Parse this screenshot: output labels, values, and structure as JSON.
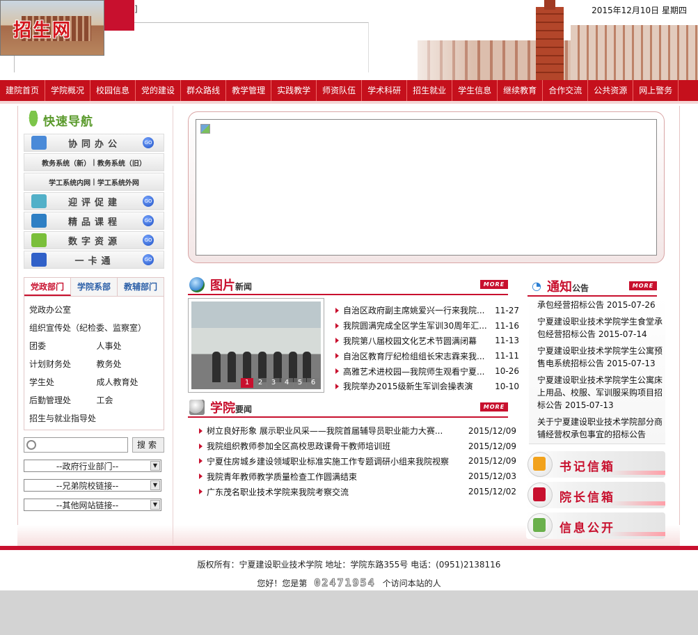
{
  "header": {
    "logo_text": "招生网",
    "bracket": "]",
    "date": "2015年12月10日  星期四"
  },
  "nav": [
    "建院首页",
    "学院概况",
    "校园信息",
    "党的建设",
    "群众路线",
    "教学管理",
    "实践教学",
    "师资队伍",
    "学术科研",
    "招生就业",
    "学生信息",
    "继续教育",
    "合作交流",
    "公共资源",
    "网上警务"
  ],
  "quick_nav": {
    "title": "快速导航",
    "buttons": [
      {
        "label": "协同办公",
        "icon": "office-icon",
        "color": "#4a8ad8"
      },
      {
        "label": "迎评促建",
        "icon": "evaluation-icon",
        "color": "#52b0c8"
      },
      {
        "label": "精品课程",
        "icon": "course-book-icon",
        "color": "#2e7fc4"
      },
      {
        "label": "数字资源",
        "icon": "monitor-icon",
        "color": "#7abf3a"
      },
      {
        "label": "一卡通",
        "icon": "card-icon",
        "color": "#3060c8"
      }
    ],
    "split1": [
      "教务系统（新）",
      "|",
      "教务系统（旧）"
    ],
    "split2": [
      "学工系统内网",
      "|",
      "学工系统外网"
    ]
  },
  "dept_tabs": [
    "党政部门",
    "学院系部",
    "教辅部门"
  ],
  "depts": [
    [
      "党政办公室"
    ],
    [
      "组织宣传处（纪检委、监察室）"
    ],
    [
      "团委",
      "人事处"
    ],
    [
      "计划财务处",
      "教务处"
    ],
    [
      "学生处",
      "成人教育处"
    ],
    [
      "后勤管理处",
      "工会"
    ],
    [
      "招生与就业指导处"
    ]
  ],
  "search": {
    "placeholder": "",
    "button": "搜索"
  },
  "selects": [
    "--政府行业部门--",
    "--兄弟院校链接--",
    "--其他网站链接--"
  ],
  "photo_news": {
    "title_big": "图片",
    "title_small": "新闻",
    "more": "MORE",
    "pages": [
      "1",
      "2",
      "3",
      "4",
      "5",
      "6"
    ],
    "items": [
      {
        "t": "自治区政府副主席姚爱兴一行来我院...",
        "d": "11-27"
      },
      {
        "t": "我院圆满完成全区学生军训30周年汇...",
        "d": "11-16"
      },
      {
        "t": "我院第八届校园文化艺术节圆满闭幕",
        "d": "11-13"
      },
      {
        "t": "自治区教育厅纪检组组长宋志霖来我...",
        "d": "11-11"
      },
      {
        "t": "高雅艺术进校园—我院师生观看宁夏...",
        "d": "10-26"
      },
      {
        "t": "我院举办2015级新生军训会操表演",
        "d": "10-10"
      }
    ]
  },
  "college_news": {
    "title_big": "学院",
    "title_small": "要闻",
    "more": "MORE",
    "items": [
      {
        "t": "树立良好形象  展示职业风采——我院首届辅导员职业能力大赛...",
        "d": "2015/12/09"
      },
      {
        "t": "我院组织教师参加全区高校思政课骨干教师培训班",
        "d": "2015/12/09"
      },
      {
        "t": "宁夏住房城乡建设领域职业标准实施工作专题调研小组来我院视察",
        "d": "2015/12/09"
      },
      {
        "t": "我院青年教师教学质量检查工作圆满结束",
        "d": "2015/12/03"
      },
      {
        "t": "广东茂名职业技术学院来我院考察交流",
        "d": "2015/12/02"
      }
    ]
  },
  "notices": {
    "title_big": "通知",
    "title_small": "公告",
    "more": "MORE",
    "items": [
      {
        "t": "承包经营招标公告",
        "d": "2015-07-26"
      },
      {
        "t": "宁夏建设职业技术学院学生食堂承包经营招标公告",
        "d": "2015-07-14"
      },
      {
        "t": "宁夏建设职业技术学院学生公寓预售电系统招标公告",
        "d": "2015-07-13"
      },
      {
        "t": "宁夏建设职业技术学院学生公寓床上用品、校服、军训服采购项目招标公告",
        "d": "2015-07-13"
      },
      {
        "t": "关于宁夏建设职业技术学院部分商铺经营权承包事宜的招标公告",
        "d": ""
      }
    ]
  },
  "mailboxes": [
    {
      "label": "书记信箱",
      "icon": "secretary-mailbox-icon",
      "color": "#f2a21c"
    },
    {
      "label": "院长信箱",
      "icon": "president-mailbox-icon",
      "color": "#c8102e"
    },
    {
      "label": "信息公开",
      "icon": "info-disclosure-icon",
      "color": "#6ab04c"
    }
  ],
  "footer": {
    "copyright": "版权所有：宁夏建设职业技术学院  地址：学院东路355号  电话：(0951)2138116",
    "visit_prefix": "您好！您是第",
    "counter": "02471954",
    "visit_suffix": "个访问本站的人"
  }
}
